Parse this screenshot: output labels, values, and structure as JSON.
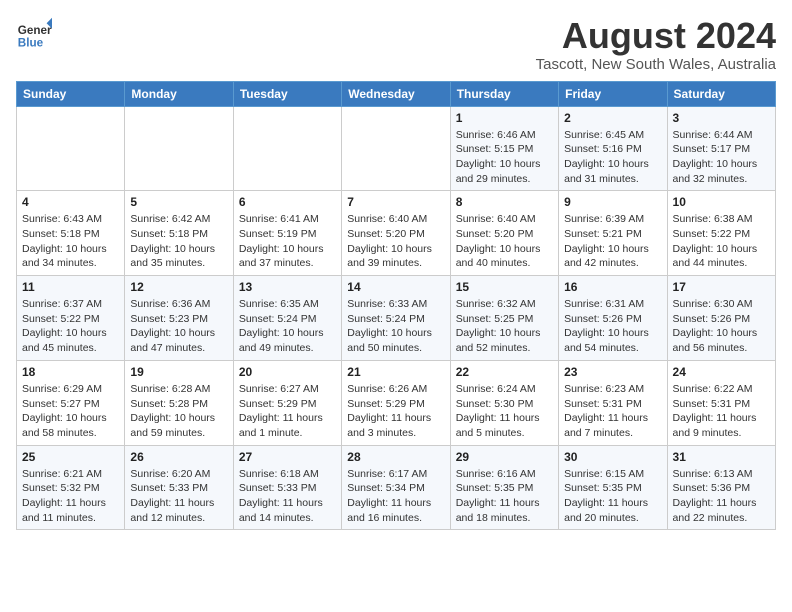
{
  "header": {
    "logo_line1": "General",
    "logo_line2": "Blue",
    "month_year": "August 2024",
    "location": "Tascott, New South Wales, Australia"
  },
  "days_of_week": [
    "Sunday",
    "Monday",
    "Tuesday",
    "Wednesday",
    "Thursday",
    "Friday",
    "Saturday"
  ],
  "weeks": [
    [
      {
        "day": "",
        "info": ""
      },
      {
        "day": "",
        "info": ""
      },
      {
        "day": "",
        "info": ""
      },
      {
        "day": "",
        "info": ""
      },
      {
        "day": "1",
        "info": "Sunrise: 6:46 AM\nSunset: 5:15 PM\nDaylight: 10 hours\nand 29 minutes."
      },
      {
        "day": "2",
        "info": "Sunrise: 6:45 AM\nSunset: 5:16 PM\nDaylight: 10 hours\nand 31 minutes."
      },
      {
        "day": "3",
        "info": "Sunrise: 6:44 AM\nSunset: 5:17 PM\nDaylight: 10 hours\nand 32 minutes."
      }
    ],
    [
      {
        "day": "4",
        "info": "Sunrise: 6:43 AM\nSunset: 5:18 PM\nDaylight: 10 hours\nand 34 minutes."
      },
      {
        "day": "5",
        "info": "Sunrise: 6:42 AM\nSunset: 5:18 PM\nDaylight: 10 hours\nand 35 minutes."
      },
      {
        "day": "6",
        "info": "Sunrise: 6:41 AM\nSunset: 5:19 PM\nDaylight: 10 hours\nand 37 minutes."
      },
      {
        "day": "7",
        "info": "Sunrise: 6:40 AM\nSunset: 5:20 PM\nDaylight: 10 hours\nand 39 minutes."
      },
      {
        "day": "8",
        "info": "Sunrise: 6:40 AM\nSunset: 5:20 PM\nDaylight: 10 hours\nand 40 minutes."
      },
      {
        "day": "9",
        "info": "Sunrise: 6:39 AM\nSunset: 5:21 PM\nDaylight: 10 hours\nand 42 minutes."
      },
      {
        "day": "10",
        "info": "Sunrise: 6:38 AM\nSunset: 5:22 PM\nDaylight: 10 hours\nand 44 minutes."
      }
    ],
    [
      {
        "day": "11",
        "info": "Sunrise: 6:37 AM\nSunset: 5:22 PM\nDaylight: 10 hours\nand 45 minutes."
      },
      {
        "day": "12",
        "info": "Sunrise: 6:36 AM\nSunset: 5:23 PM\nDaylight: 10 hours\nand 47 minutes."
      },
      {
        "day": "13",
        "info": "Sunrise: 6:35 AM\nSunset: 5:24 PM\nDaylight: 10 hours\nand 49 minutes."
      },
      {
        "day": "14",
        "info": "Sunrise: 6:33 AM\nSunset: 5:24 PM\nDaylight: 10 hours\nand 50 minutes."
      },
      {
        "day": "15",
        "info": "Sunrise: 6:32 AM\nSunset: 5:25 PM\nDaylight: 10 hours\nand 52 minutes."
      },
      {
        "day": "16",
        "info": "Sunrise: 6:31 AM\nSunset: 5:26 PM\nDaylight: 10 hours\nand 54 minutes."
      },
      {
        "day": "17",
        "info": "Sunrise: 6:30 AM\nSunset: 5:26 PM\nDaylight: 10 hours\nand 56 minutes."
      }
    ],
    [
      {
        "day": "18",
        "info": "Sunrise: 6:29 AM\nSunset: 5:27 PM\nDaylight: 10 hours\nand 58 minutes."
      },
      {
        "day": "19",
        "info": "Sunrise: 6:28 AM\nSunset: 5:28 PM\nDaylight: 10 hours\nand 59 minutes."
      },
      {
        "day": "20",
        "info": "Sunrise: 6:27 AM\nSunset: 5:29 PM\nDaylight: 11 hours\nand 1 minute."
      },
      {
        "day": "21",
        "info": "Sunrise: 6:26 AM\nSunset: 5:29 PM\nDaylight: 11 hours\nand 3 minutes."
      },
      {
        "day": "22",
        "info": "Sunrise: 6:24 AM\nSunset: 5:30 PM\nDaylight: 11 hours\nand 5 minutes."
      },
      {
        "day": "23",
        "info": "Sunrise: 6:23 AM\nSunset: 5:31 PM\nDaylight: 11 hours\nand 7 minutes."
      },
      {
        "day": "24",
        "info": "Sunrise: 6:22 AM\nSunset: 5:31 PM\nDaylight: 11 hours\nand 9 minutes."
      }
    ],
    [
      {
        "day": "25",
        "info": "Sunrise: 6:21 AM\nSunset: 5:32 PM\nDaylight: 11 hours\nand 11 minutes."
      },
      {
        "day": "26",
        "info": "Sunrise: 6:20 AM\nSunset: 5:33 PM\nDaylight: 11 hours\nand 12 minutes."
      },
      {
        "day": "27",
        "info": "Sunrise: 6:18 AM\nSunset: 5:33 PM\nDaylight: 11 hours\nand 14 minutes."
      },
      {
        "day": "28",
        "info": "Sunrise: 6:17 AM\nSunset: 5:34 PM\nDaylight: 11 hours\nand 16 minutes."
      },
      {
        "day": "29",
        "info": "Sunrise: 6:16 AM\nSunset: 5:35 PM\nDaylight: 11 hours\nand 18 minutes."
      },
      {
        "day": "30",
        "info": "Sunrise: 6:15 AM\nSunset: 5:35 PM\nDaylight: 11 hours\nand 20 minutes."
      },
      {
        "day": "31",
        "info": "Sunrise: 6:13 AM\nSunset: 5:36 PM\nDaylight: 11 hours\nand 22 minutes."
      }
    ]
  ]
}
